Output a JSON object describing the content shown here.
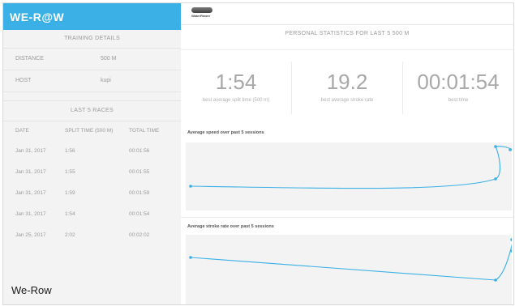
{
  "app": {
    "brand": "WE-R@W",
    "caption": "We-Row"
  },
  "logo": {
    "subtext": "WaterRower"
  },
  "training_details": {
    "title": "TRAINING DETAILS",
    "rows": [
      {
        "label": "DISTANCE",
        "value": "500 M"
      },
      {
        "label": "HOST",
        "value": "kupi"
      }
    ]
  },
  "races": {
    "title": "LAST 5 RACES",
    "columns": [
      "DATE",
      "SPLIT TIME (500 M)",
      "TOTAL TIME"
    ],
    "rows": [
      [
        "Jan 31, 2017",
        "1:56",
        "00:01:56"
      ],
      [
        "Jan 31, 2017",
        "1:55",
        "00:01:55"
      ],
      [
        "Jan 31, 2017",
        "1:59",
        "00:01:59"
      ],
      [
        "Jan 31, 2017",
        "1:54",
        "00:01:54"
      ],
      [
        "Jan 25, 2017",
        "2:02",
        "00:02:02"
      ]
    ]
  },
  "stats": {
    "title": "PERSONAL STATISTICS FOR LAST 5 500 M",
    "items": [
      {
        "value": "1:54",
        "label": "best average split time (500 m)"
      },
      {
        "value": "19.2",
        "label": "best average stroke rate"
      },
      {
        "value": "00:01:54",
        "label": "best time"
      }
    ]
  },
  "charts": {
    "speed_title": "Average speed over past 5 sessions",
    "stroke_title": "Average stroke rate over past 5 sessions"
  },
  "colors": {
    "brand": "#3ab0e6",
    "chart_line": "#3ab0e6"
  }
}
